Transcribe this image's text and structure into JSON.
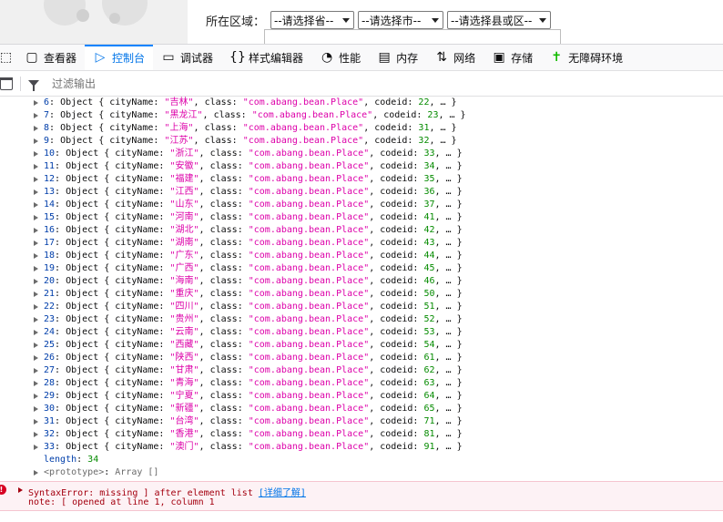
{
  "page": {
    "region_label": "所在区域：",
    "province_select": "--请选择省--",
    "city_select": "--请选择市--",
    "county_select": "--请选择县或区--"
  },
  "devtools": {
    "tabs": [
      {
        "label": "查看器",
        "icon": "inspector-icon"
      },
      {
        "label": "控制台",
        "icon": "console-icon"
      },
      {
        "label": "调试器",
        "icon": "debugger-icon"
      },
      {
        "label": "样式编辑器",
        "icon": "style-editor-icon"
      },
      {
        "label": "性能",
        "icon": "performance-icon"
      },
      {
        "label": "内存",
        "icon": "memory-icon"
      },
      {
        "label": "网络",
        "icon": "network-icon"
      },
      {
        "label": "存储",
        "icon": "storage-icon"
      },
      {
        "label": "无障碍环境",
        "icon": "accessibility-icon"
      }
    ],
    "filter_placeholder": "过滤输出"
  },
  "console": {
    "entries": [
      {
        "index": "6",
        "city": "吉林",
        "cls": "com.abang.bean.Place",
        "codeid": "22"
      },
      {
        "index": "7",
        "city": "黑龙江",
        "cls": "com.abang.bean.Place",
        "codeid": "23"
      },
      {
        "index": "8",
        "city": "上海",
        "cls": "com.abang.bean.Place",
        "codeid": "31"
      },
      {
        "index": "9",
        "city": "江苏",
        "cls": "com.abang.bean.Place",
        "codeid": "32"
      },
      {
        "index": "10",
        "city": "浙江",
        "cls": "com.abang.bean.Place",
        "codeid": "33"
      },
      {
        "index": "11",
        "city": "安徽",
        "cls": "com.abang.bean.Place",
        "codeid": "34"
      },
      {
        "index": "12",
        "city": "福建",
        "cls": "com.abang.bean.Place",
        "codeid": "35"
      },
      {
        "index": "13",
        "city": "江西",
        "cls": "com.abang.bean.Place",
        "codeid": "36"
      },
      {
        "index": "14",
        "city": "山东",
        "cls": "com.abang.bean.Place",
        "codeid": "37"
      },
      {
        "index": "15",
        "city": "河南",
        "cls": "com.abang.bean.Place",
        "codeid": "41"
      },
      {
        "index": "16",
        "city": "湖北",
        "cls": "com.abang.bean.Place",
        "codeid": "42"
      },
      {
        "index": "17",
        "city": "湖南",
        "cls": "com.abang.bean.Place",
        "codeid": "43"
      },
      {
        "index": "18",
        "city": "广东",
        "cls": "com.abang.bean.Place",
        "codeid": "44"
      },
      {
        "index": "19",
        "city": "广西",
        "cls": "com.abang.bean.Place",
        "codeid": "45"
      },
      {
        "index": "20",
        "city": "海南",
        "cls": "com.abang.bean.Place",
        "codeid": "46"
      },
      {
        "index": "21",
        "city": "重庆",
        "cls": "com.abang.bean.Place",
        "codeid": "50"
      },
      {
        "index": "22",
        "city": "四川",
        "cls": "com.abang.bean.Place",
        "codeid": "51"
      },
      {
        "index": "23",
        "city": "贵州",
        "cls": "com.abang.bean.Place",
        "codeid": "52"
      },
      {
        "index": "24",
        "city": "云南",
        "cls": "com.abang.bean.Place",
        "codeid": "53"
      },
      {
        "index": "25",
        "city": "西藏",
        "cls": "com.abang.bean.Place",
        "codeid": "54"
      },
      {
        "index": "26",
        "city": "陕西",
        "cls": "com.abang.bean.Place",
        "codeid": "61"
      },
      {
        "index": "27",
        "city": "甘肃",
        "cls": "com.abang.bean.Place",
        "codeid": "62"
      },
      {
        "index": "28",
        "city": "青海",
        "cls": "com.abang.bean.Place",
        "codeid": "63"
      },
      {
        "index": "29",
        "city": "宁夏",
        "cls": "com.abang.bean.Place",
        "codeid": "64"
      },
      {
        "index": "30",
        "city": "新疆",
        "cls": "com.abang.bean.Place",
        "codeid": "65"
      },
      {
        "index": "31",
        "city": "台湾",
        "cls": "com.abang.bean.Place",
        "codeid": "71"
      },
      {
        "index": "32",
        "city": "香港",
        "cls": "com.abang.bean.Place",
        "codeid": "81"
      },
      {
        "index": "33",
        "city": "澳门",
        "cls": "com.abang.bean.Place",
        "codeid": "91"
      }
    ],
    "length_label": "length",
    "length_value": "34",
    "prototype_label": "<prototype>",
    "prototype_value": "Array []",
    "error_line1": "SyntaxError: missing ] after element list",
    "error_learn_more": "[详细了解]",
    "error_line2": "note: [ opened at line 1, column 1"
  },
  "colors": {
    "accent": "#0a84ff",
    "string": "#dd00a9",
    "number": "#058b00",
    "keyword": "#003eaa",
    "error": "#a4000f"
  }
}
